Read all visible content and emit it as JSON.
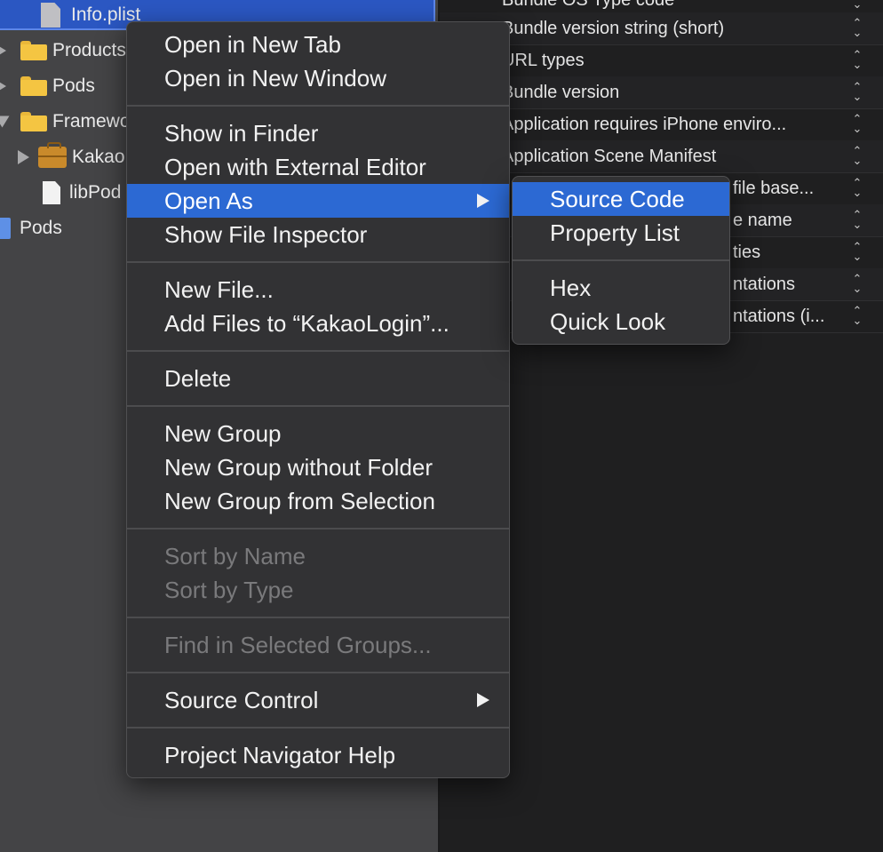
{
  "navigator": {
    "selected_file": "Info.plist",
    "rows": [
      {
        "label": "Products"
      },
      {
        "label": "Pods"
      },
      {
        "label": "Framewo"
      },
      {
        "label": "Kakao"
      },
      {
        "label": "libPod"
      },
      {
        "label": "Pods"
      }
    ]
  },
  "inspector": {
    "rows": [
      {
        "key": "Bundle OS Type code"
      },
      {
        "key": "Bundle version string (short)"
      },
      {
        "key": "URL types"
      },
      {
        "key": "Bundle version"
      },
      {
        "key": "Application requires iPhone enviro..."
      },
      {
        "key": "Application Scene Manifest"
      },
      {
        "key": "file base..."
      },
      {
        "key": "e name"
      },
      {
        "key": "ties"
      },
      {
        "key": "ntations"
      },
      {
        "key": "ntations (i..."
      }
    ]
  },
  "context_menu": {
    "open_in_new_tab": "Open in New Tab",
    "open_in_new_window": "Open in New Window",
    "show_in_finder": "Show in Finder",
    "open_with_external_editor": "Open with External Editor",
    "open_as": "Open As",
    "show_file_inspector": "Show File Inspector",
    "new_file": "New File...",
    "add_files": "Add Files to “KakaoLogin”...",
    "delete": "Delete",
    "new_group": "New Group",
    "new_group_without_folder": "New Group without Folder",
    "new_group_from_selection": "New Group from Selection",
    "sort_by_name": "Sort by Name",
    "sort_by_type": "Sort by Type",
    "find_in_selected_groups": "Find in Selected Groups...",
    "source_control": "Source Control",
    "project_navigator_help": "Project Navigator Help"
  },
  "submenu": {
    "source_code": "Source Code",
    "property_list": "Property List",
    "hex": "Hex",
    "quick_look": "Quick Look"
  },
  "colors": {
    "highlight": "#2c69d3",
    "menu_bg": "#323234",
    "navigator_bg": "#444446",
    "folder": "#f4c542"
  }
}
